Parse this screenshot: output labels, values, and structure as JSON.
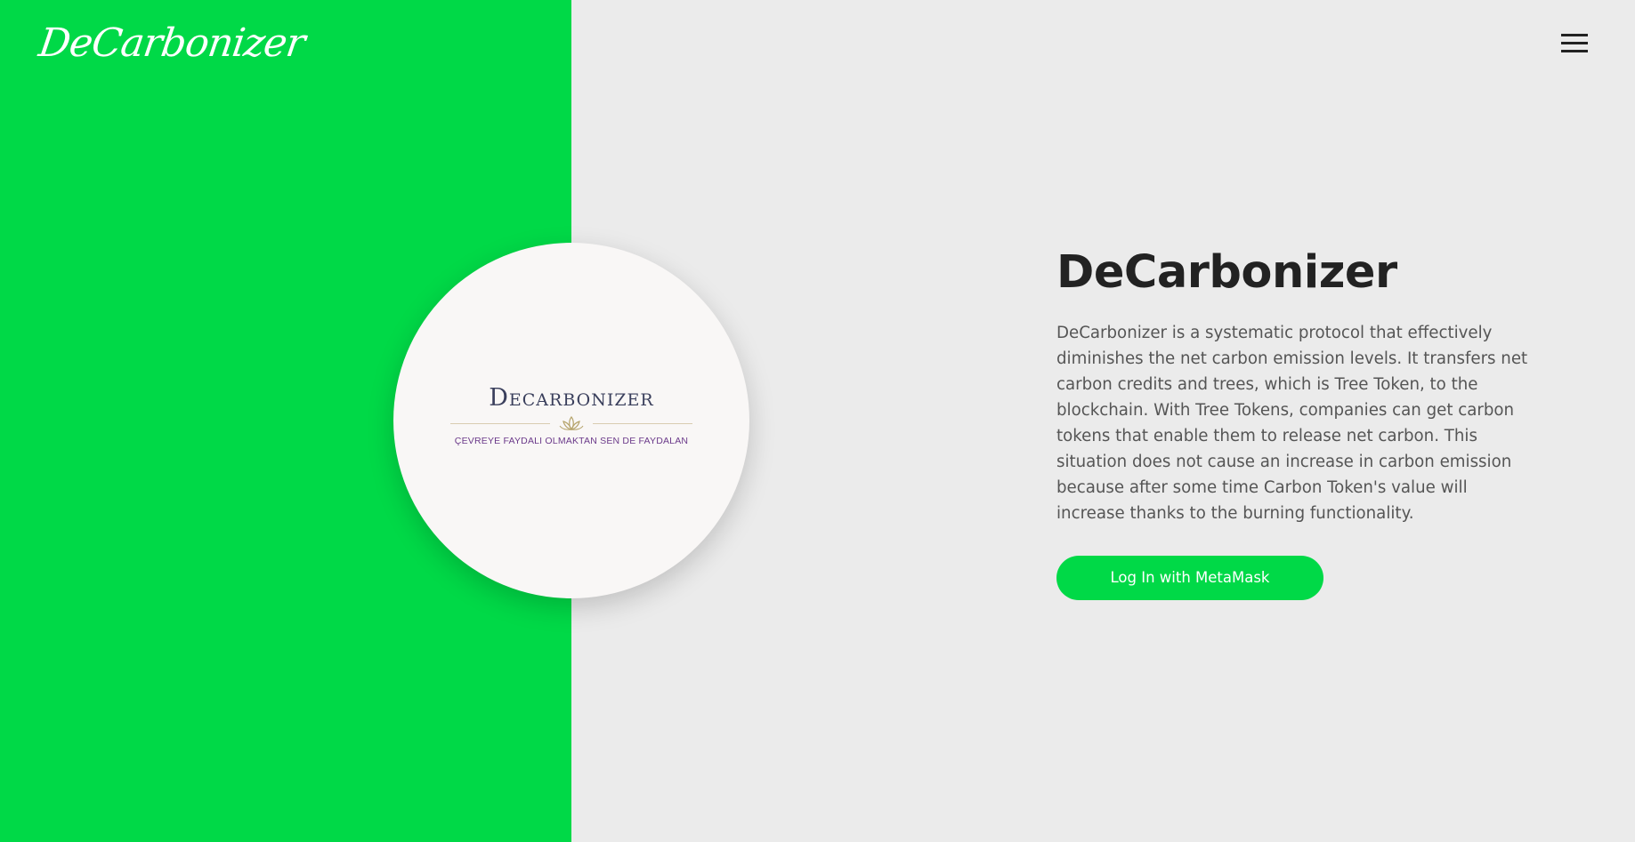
{
  "header": {
    "brand": "DeCarbonizer",
    "menu_icon": "hamburger-menu-icon"
  },
  "hero": {
    "logo_title": "Decarbonizer",
    "logo_tagline": "ÇEVREYE FAYDALI OLMAKTAN SEN DE FAYDALAN",
    "logo_icon": "lotus-icon",
    "headline": "DeCarbonizer",
    "description": "DeCarbonizer is a systematic protocol that effectively diminishes the net carbon emission levels. It transfers net carbon credits and trees, which is Tree Token, to the blockchain. With Tree Tokens, companies can get carbon tokens that enable them to release net carbon. This situation does not cause an increase in carbon emission because after some time Carbon Token's value will increase thanks to the burning functionality.",
    "cta_label": "Log In with MetaMask"
  },
  "colors": {
    "accent": "#00d947",
    "background": "#ebebeb",
    "headline": "#222222",
    "body_text": "#555555"
  }
}
